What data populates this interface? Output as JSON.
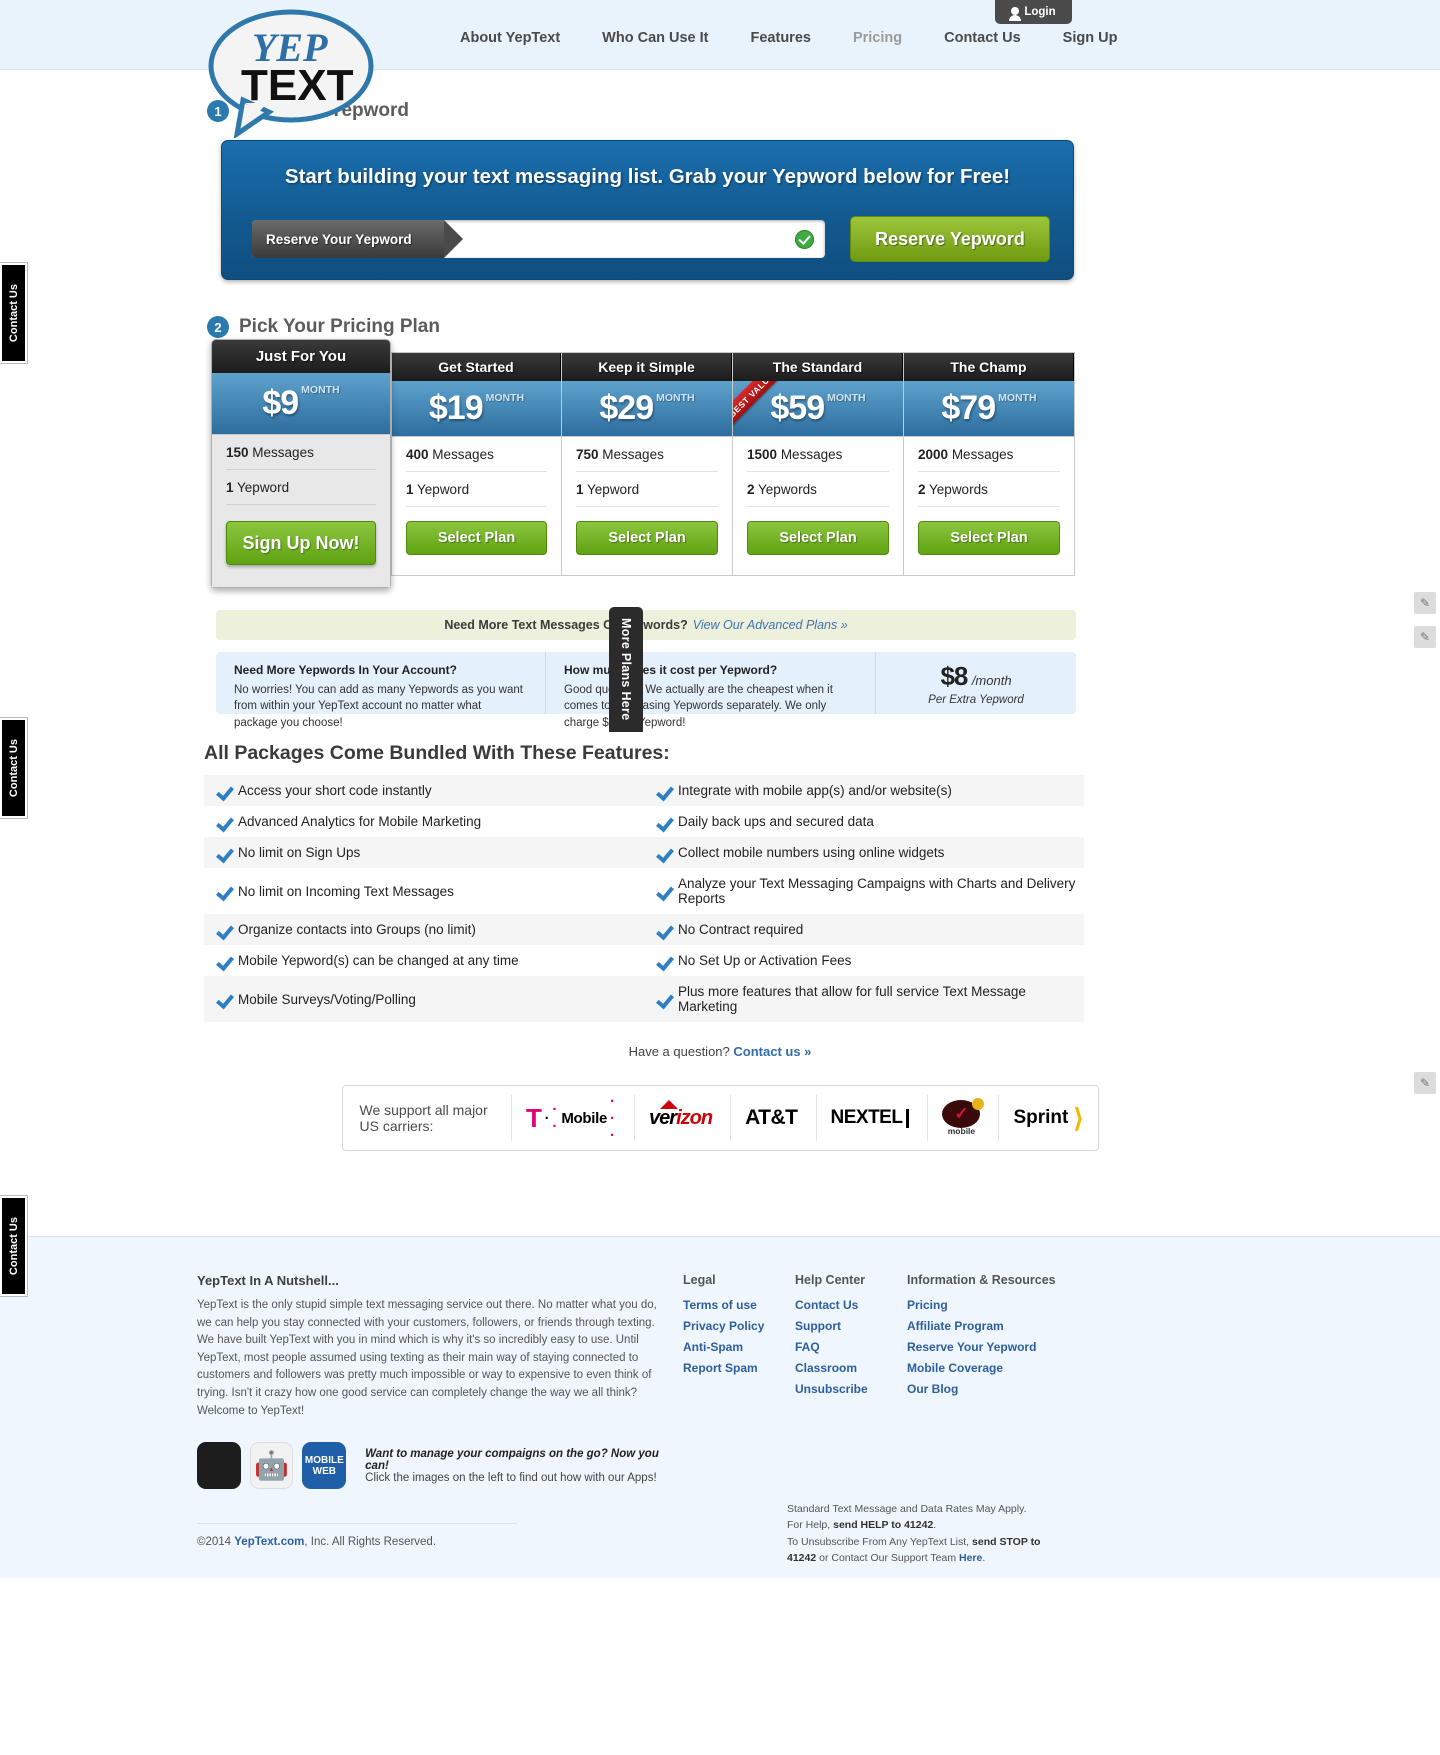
{
  "header": {
    "login_label": "Login",
    "nav": [
      {
        "label": "About YepText",
        "current": false
      },
      {
        "label": "Who Can Use It",
        "current": false
      },
      {
        "label": "Features",
        "current": false
      },
      {
        "label": "Pricing",
        "current": true
      },
      {
        "label": "Contact Us",
        "current": false
      },
      {
        "label": "Sign Up",
        "current": false
      }
    ],
    "logo_top": "YEP",
    "logo_bottom": "TEXT"
  },
  "step1": {
    "number": "1",
    "title": "Pick Your Yepword",
    "banner_title": "Start building your text messaging list. Grab your Yepword below for Free!",
    "field_label": "Reserve Your Yepword",
    "field_value": "",
    "field_placeholder": "",
    "button_label": "Reserve Yepword"
  },
  "step2": {
    "number": "2",
    "title": "Pick Your Pricing Plan",
    "plans": [
      {
        "name": "Just For You",
        "price": "$9",
        "per": "MONTH",
        "messages_num": "150",
        "messages_label": "Messages",
        "yepwords_num": "1",
        "yepwords_label": "Yepword",
        "cta": "Sign Up Now!",
        "featured": true,
        "ribbon": ""
      },
      {
        "name": "Get Started",
        "price": "$19",
        "per": "MONTH",
        "messages_num": "400",
        "messages_label": "Messages",
        "yepwords_num": "1",
        "yepwords_label": "Yepword",
        "cta": "Select Plan",
        "featured": false,
        "ribbon": ""
      },
      {
        "name": "Keep it Simple",
        "price": "$29",
        "per": "MONTH",
        "messages_num": "750",
        "messages_label": "Messages",
        "yepwords_num": "1",
        "yepwords_label": "Yepword",
        "cta": "Select Plan",
        "featured": false,
        "ribbon": ""
      },
      {
        "name": "The Standard",
        "price": "$59",
        "per": "MONTH",
        "messages_num": "1500",
        "messages_label": "Messages",
        "yepwords_num": "2",
        "yepwords_label": "Yepwords",
        "cta": "Select Plan",
        "featured": false,
        "ribbon": "BEST VALUE"
      },
      {
        "name": "The Champ",
        "price": "$79",
        "per": "MONTH",
        "messages_num": "2000",
        "messages_label": "Messages",
        "yepwords_num": "2",
        "yepwords_label": "Yepwords",
        "cta": "Select Plan",
        "featured": false,
        "ribbon": ""
      }
    ]
  },
  "advanced_bar": {
    "text": "Need More Text Messages Or Yepwords?",
    "link": "View Our Advanced Plans »"
  },
  "more_plans_tab": "More Plans Here",
  "faq": {
    "items": [
      {
        "question": "Need More Yepwords In Your Account?",
        "answer": "No worries! You can add as many Yepwords as you want from within your YepText account no matter what package you choose!"
      },
      {
        "question": "How much does it cost per Yepword?",
        "answer": "Good question! We actually are the cheapest when it comes to purchasing Yepwords separately. We only charge $8 per Yepword!"
      }
    ],
    "price_big": "$8",
    "price_mo": "/month",
    "price_sub": "Per Extra Yepword"
  },
  "features": {
    "title": "All Packages Come Bundled With These Features:",
    "rows": [
      [
        "Access your short code instantly",
        "Integrate with mobile app(s) and/or website(s)"
      ],
      [
        "Advanced Analytics for Mobile Marketing",
        "Daily back ups and secured data"
      ],
      [
        "No limit on Sign Ups",
        "Collect mobile numbers using online widgets"
      ],
      [
        "No limit on Incoming Text Messages",
        "Analyze your Text Messaging Campaigns with Charts and Delivery Reports"
      ],
      [
        "Organize contacts into Groups (no limit)",
        "No Contract required"
      ],
      [
        "Mobile Yepword(s) can be changed at any time",
        "No Set Up or Activation Fees"
      ],
      [
        "Mobile Surveys/Voting/Polling",
        "Plus more features that allow for full service Text Message Marketing"
      ]
    ],
    "question_text": "Have a question?",
    "question_link": "Contact us »"
  },
  "carriers": {
    "label": "We support all major US carriers:",
    "names": [
      "T-Mobile",
      "Verizon",
      "AT&T",
      "NEXTEL",
      "Virgin Mobile",
      "Sprint"
    ]
  },
  "footer": {
    "about_title": "YepText In A Nutshell...",
    "about_text": "YepText is the only stupid simple text messaging service out there. No matter what you do, we can help you stay connected with your customers, followers, or friends through texting. We have built YepText with you in mind which is why it's so incredibly easy to use. Until YepText, most people assumed using texting as their main way of staying connected to customers and followers was pretty much impossible or way to expensive to even think of trying. Isn't it crazy how one good service can completely change the way we all think? Welcome to YepText!",
    "apps_line1": "Want to manage your compaigns on the go? Now you can!",
    "apps_line2": "Click the images on the left to find out how with our Apps!",
    "app_web_label_1": "MOBILE",
    "app_web_label_2": "WEB",
    "columns": [
      {
        "title": "Legal",
        "links": [
          "Terms of use",
          "Privacy Policy",
          "Anti-Spam",
          "Report Spam"
        ]
      },
      {
        "title": "Help Center",
        "links": [
          "Contact Us",
          "Support",
          "FAQ",
          "Classroom",
          "Unsubscribe"
        ]
      },
      {
        "title": "Information & Resources",
        "links": [
          "Pricing",
          "Affiliate Program",
          "Reserve Your Yepword",
          "Mobile Coverage",
          "Our Blog"
        ]
      }
    ],
    "copyright_pre": "©2014 ",
    "copyright_brand": "YepText.com",
    "copyright_post": ", Inc. All Rights Reserved.",
    "legal_l1": "Standard Text Message and Data Rates May Apply.",
    "legal_l2a": "For Help, ",
    "legal_l2b": "send HELP to 41242",
    "legal_l2c": ".",
    "legal_l3a": "To Unsubscribe From Any YepText List, ",
    "legal_l3b": "send STOP to",
    "legal_l4a": "41242",
    "legal_l4b": " or Contact Our Support Team ",
    "legal_l4c": "Here",
    "legal_l4d": "."
  },
  "side_tabs": {
    "contact_label": "Contact Us"
  }
}
